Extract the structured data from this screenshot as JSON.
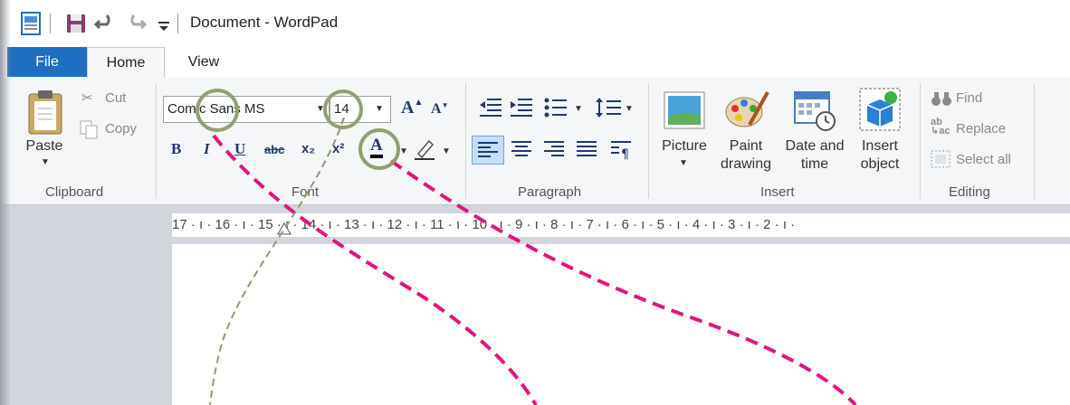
{
  "app": {
    "title": "Document - WordPad"
  },
  "tabs": {
    "file": "File",
    "home": "Home",
    "view": "View"
  },
  "clipboard": {
    "paste": "Paste",
    "cut": "Cut",
    "copy": "Copy",
    "group": "Clipboard"
  },
  "font": {
    "family": "Comic Sans MS",
    "size": "14",
    "group": "Font",
    "bold": "B",
    "italic": "I",
    "underline": "U",
    "strike": "abc",
    "subscript": "x₂",
    "superscript": "x²",
    "color_letter": "A"
  },
  "paragraph": {
    "group": "Paragraph"
  },
  "insert": {
    "picture": "Picture",
    "paint_1": "Paint",
    "paint_2": "drawing",
    "datetime_1": "Date and",
    "datetime_2": "time",
    "object_1": "Insert",
    "object_2": "object",
    "group": "Insert"
  },
  "editing": {
    "find": "Find",
    "replace": "Replace",
    "select_all": "Select all",
    "group": "Editing"
  },
  "ruler": {
    "marks": [
      "17",
      "16",
      "15",
      "14",
      "13",
      "12",
      "11",
      "10",
      "9",
      "8",
      "7",
      "6",
      "5",
      "4",
      "3",
      "2"
    ]
  },
  "colors": {
    "accent": "#1e6fc1",
    "annotation_circle": "#8fa072",
    "annotation_pink": "#e0157f",
    "annotation_olive": "#9b9670"
  }
}
